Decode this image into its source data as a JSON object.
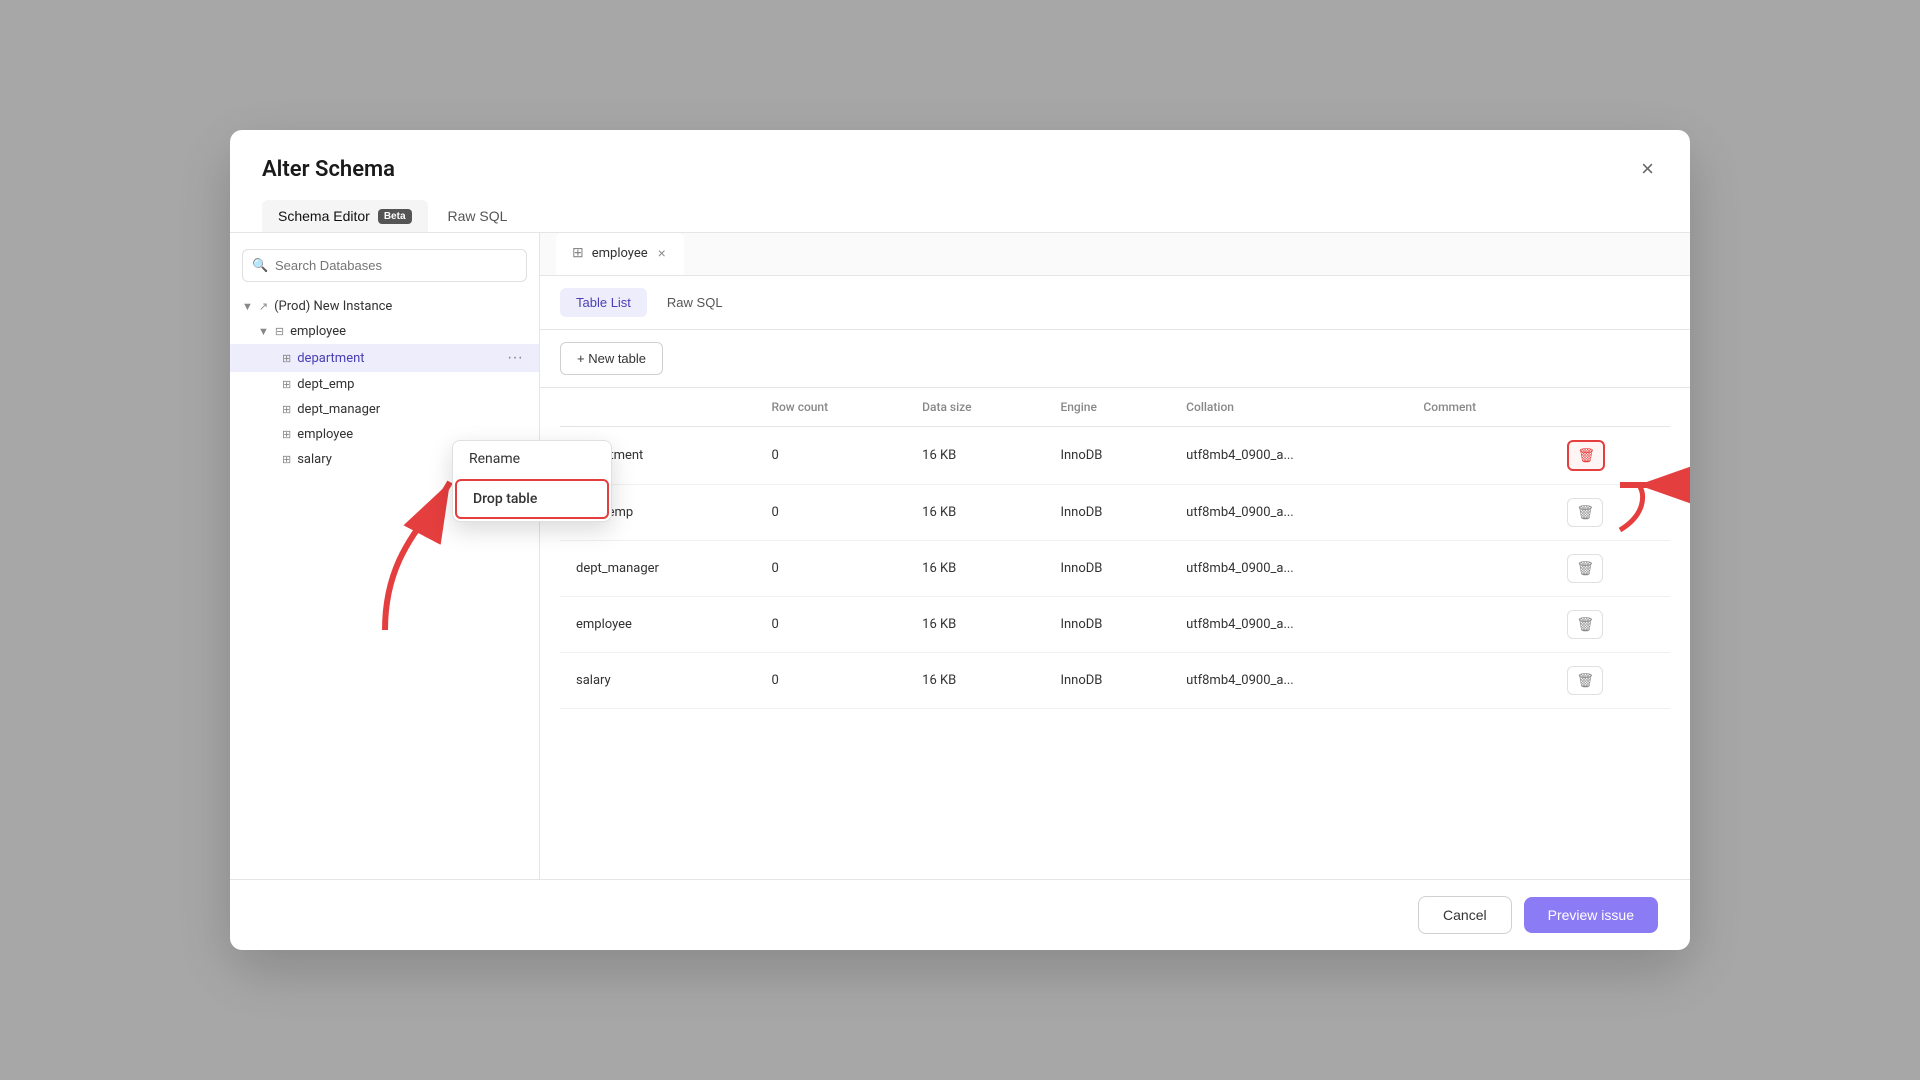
{
  "modal": {
    "title": "Alter Schema",
    "close_label": "×"
  },
  "tabs": {
    "schema_editor": "Schema Editor",
    "schema_editor_badge": "Beta",
    "raw_sql": "Raw SQL"
  },
  "sidebar": {
    "search_placeholder": "Search Databases",
    "tree": [
      {
        "id": "prod-instance",
        "label": "(Prod) New Instance",
        "level": 0,
        "type": "instance",
        "expanded": true
      },
      {
        "id": "employee-db",
        "label": "employee",
        "level": 1,
        "type": "database",
        "expanded": true
      },
      {
        "id": "department",
        "label": "department",
        "level": 2,
        "type": "table",
        "selected": true
      },
      {
        "id": "dept_emp",
        "label": "dept_emp",
        "level": 2,
        "type": "table"
      },
      {
        "id": "dept_manager",
        "label": "dept_manager",
        "level": 2,
        "type": "table"
      },
      {
        "id": "employee-table",
        "label": "employee",
        "level": 2,
        "type": "table"
      },
      {
        "id": "salary",
        "label": "salary",
        "level": 2,
        "type": "table"
      }
    ]
  },
  "context_menu": {
    "rename": "Rename",
    "drop_table": "Drop table"
  },
  "db_tab": {
    "icon": "⊞",
    "name": "employee",
    "close": "×"
  },
  "content_tabs": {
    "table_list": "Table List",
    "raw_sql": "Raw SQL"
  },
  "toolbar": {
    "new_table": "+ New table"
  },
  "table": {
    "columns": [
      "",
      "Row count",
      "Data size",
      "Engine",
      "Collation",
      "Comment",
      ""
    ],
    "rows": [
      {
        "name": "department",
        "row_count": "0",
        "data_size": "16 KB",
        "engine": "InnoDB",
        "collation": "utf8mb4_0900_a...",
        "comment": "",
        "highlighted": true
      },
      {
        "name": "dept_emp",
        "row_count": "0",
        "data_size": "16 KB",
        "engine": "InnoDB",
        "collation": "utf8mb4_0900_a...",
        "comment": "",
        "highlighted": false
      },
      {
        "name": "dept_manager",
        "row_count": "0",
        "data_size": "16 KB",
        "engine": "InnoDB",
        "collation": "utf8mb4_0900_a...",
        "comment": "",
        "highlighted": false
      },
      {
        "name": "employee",
        "row_count": "0",
        "data_size": "16 KB",
        "engine": "InnoDB",
        "collation": "utf8mb4_0900_a...",
        "comment": "",
        "highlighted": false
      },
      {
        "name": "salary",
        "row_count": "0",
        "data_size": "16 KB",
        "engine": "InnoDB",
        "collation": "utf8mb4_0900_a...",
        "comment": "",
        "highlighted": false
      }
    ]
  },
  "footer": {
    "cancel": "Cancel",
    "preview": "Preview issue"
  }
}
